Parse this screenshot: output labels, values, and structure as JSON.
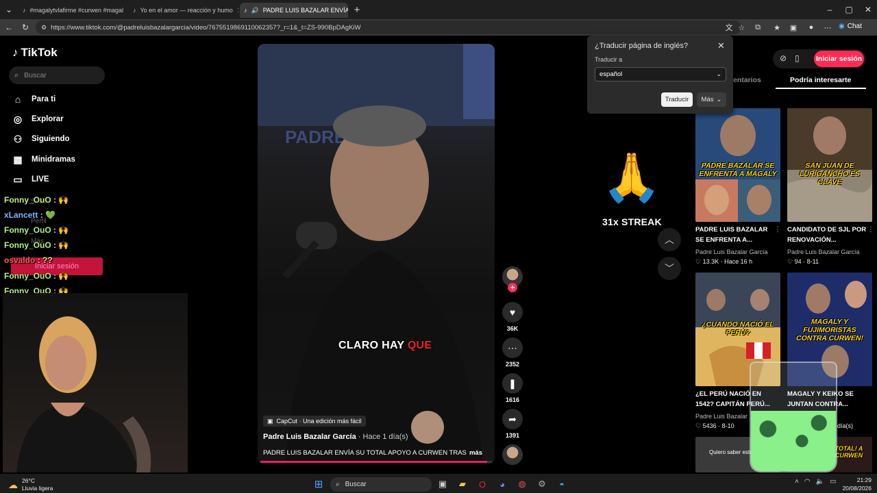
{
  "browser": {
    "tabs": [
      {
        "label": "#magalytvlafirme #curwen #magal"
      },
      {
        "label": "Yo en el amor — reacción y humo"
      },
      {
        "label": "PADRE LUIS BAZALAR ENVÍA"
      }
    ],
    "url": "https://www.tiktok.com/@padreluisbazalargarcia/video/7675519869110062357?_r=1&_t=ZS-990BpDAgKiW",
    "copilot_label": "Chat"
  },
  "sidebar": {
    "logo": "TikTok",
    "search_placeholder": "Buscar",
    "items": [
      {
        "label": "Para ti",
        "icon": "home-icon"
      },
      {
        "label": "Explorar",
        "icon": "compass-icon"
      },
      {
        "label": "Siguiendo",
        "icon": "following-icon"
      },
      {
        "label": "Minidramas",
        "icon": "film-icon"
      },
      {
        "label": "LIVE",
        "icon": "live-icon"
      }
    ],
    "hidden_items": [
      "Subir",
      "Perfil",
      "Más"
    ],
    "login_button": "Iniciar sesión"
  },
  "chat": [
    {
      "user": "Fonny_OuO",
      "text": ": 🙌",
      "color": "green"
    },
    {
      "user": "xLancett",
      "text": ": 💚",
      "color": "blue"
    },
    {
      "user": "Fonny_OuO",
      "text": ": 🙌",
      "color": "green"
    },
    {
      "user": "Fonny_OuO",
      "text": ": 🙌",
      "color": "green"
    },
    {
      "user": "osvaldo",
      "text": ": ??",
      "color": "red"
    },
    {
      "user": "Fonny_OuO",
      "text": ": 🙌",
      "color": "green"
    },
    {
      "user": "Fonny_OuO",
      "text": ": 🙌",
      "color": "green"
    }
  ],
  "video": {
    "caption_white": "CLARO HAY",
    "caption_red": "QUE",
    "capcut": "CapCut · Una edición más fácil",
    "author": "Padre Luis Bazalar García",
    "date": " · Hace 1 día(s)",
    "description": "PADRE LUIS BAZALAR ENVÍA SU TOTAL APOYO A CURWEN TRAS",
    "more": "más",
    "progress": 0.98,
    "likes": "36K",
    "comments": "2352",
    "saves": "1616",
    "shares": "1391"
  },
  "streak": {
    "text": "31x STREAK"
  },
  "translate": {
    "title": "¿Traducir página de inglés?",
    "label": "Traducir a",
    "language": "español",
    "translate_button": "Traducir",
    "more_button": "Más"
  },
  "right": {
    "login": "Iniciar sesión",
    "tab_comments": "entarios",
    "tab_suggest": "Podría interesarte",
    "recommendations": [
      {
        "banner": "PADRE BAZALAR SE ENFRENTA A MAGALY",
        "title": "PADRE LUIS BAZALAR SE ENFRENTA A...",
        "author": "Padre Luis Bazalar García",
        "likes": "13.3K",
        "age": "Hace 16 h"
      },
      {
        "banner": "SAN JUAN DE LURIGANCHO ES CLAVE",
        "title": "CANDIDATO DE SJL POR RENOVACIÓN...",
        "author": "Padre Luis Bazalar García",
        "likes": "94",
        "age": "8-11"
      },
      {
        "banner": "¿CUANDO NACIÓ EL PERÚ?",
        "title": "¿EL PERÚ NACIÓ EN 1542? CAPITÁN PERÚ...",
        "author": "Padre Luis Bazalar",
        "likes": "5436",
        "age": "8-10"
      },
      {
        "banner": "MAGALY Y FUJIMORISTAS CONTRA CURWEN!",
        "title": "MAGALY Y KEIKO SE JUNTAN CONTRA...",
        "author": "",
        "likes": "",
        "age": "día(s)"
      }
    ],
    "bottom_left_text": "Quiero saber este",
    "bottom_right_banner": "TOTAL! A CURWEN"
  },
  "taskbar": {
    "temp": "26°C",
    "weather": "Lluvia ligera",
    "search": "Buscar",
    "time": "21:29",
    "date": "20/08/2026"
  }
}
